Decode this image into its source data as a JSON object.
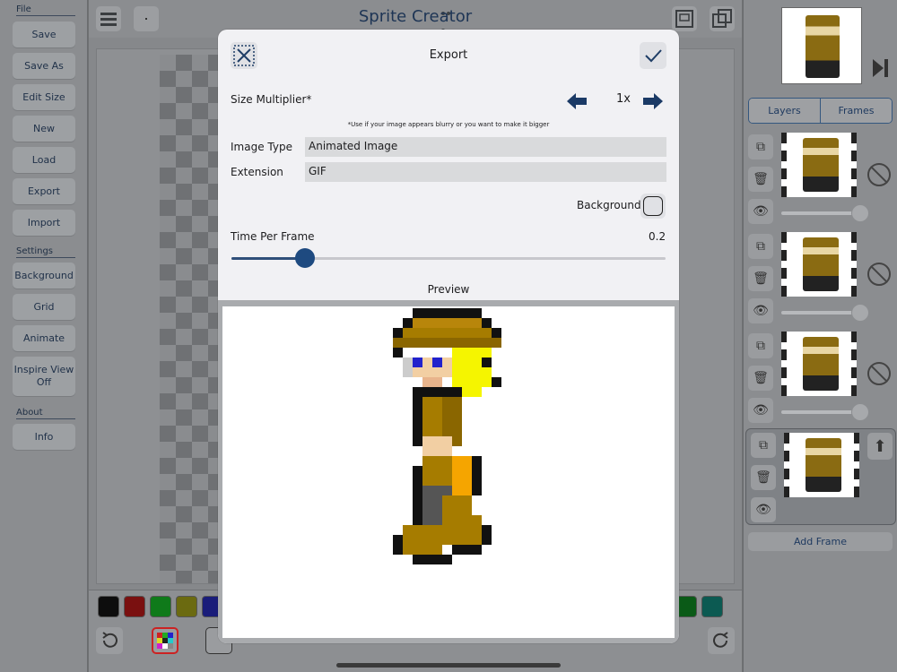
{
  "app_title": "Sprite Creator",
  "sidebar": {
    "file_header": "File",
    "file_items": [
      "Save",
      "Save As",
      "Edit Size",
      "New",
      "Load",
      "Export",
      "Import"
    ],
    "settings_header": "Settings",
    "settings_items": [
      "Background",
      "Grid",
      "Animate",
      "Inspire View\nOff"
    ],
    "about_header": "About",
    "about_items": [
      "Info"
    ]
  },
  "palette": {
    "colors": [
      "#0d0d0d",
      "#7a1010",
      "#0f7a1a",
      "#6b6a10",
      "#1a1d7a",
      "#0a5a17",
      "#0c5a52"
    ]
  },
  "right_panel": {
    "tabs": [
      "Layers",
      "Frames"
    ],
    "add_frame_label": "Add Frame",
    "frames": [
      {
        "selected": false,
        "opacity": 1.0
      },
      {
        "selected": false,
        "opacity": 1.0
      },
      {
        "selected": false,
        "opacity": 1.0
      },
      {
        "selected": true,
        "opacity": 1.0
      }
    ]
  },
  "export_dialog": {
    "title": "Export",
    "size_multiplier_label": "Size Multiplier*",
    "size_multiplier_value": "1x",
    "size_multiplier_note": "*Use if your image appears blurry or you want to make it bigger",
    "image_type_label": "Image Type",
    "image_type_value": "Animated Image",
    "extension_label": "Extension",
    "extension_value": "GIF",
    "background_label": "Background",
    "background_checked": false,
    "time_per_frame_label": "Time Per Frame",
    "time_per_frame_value": "0.2",
    "time_per_frame_fraction": 0.17,
    "preview_label": "Preview"
  }
}
